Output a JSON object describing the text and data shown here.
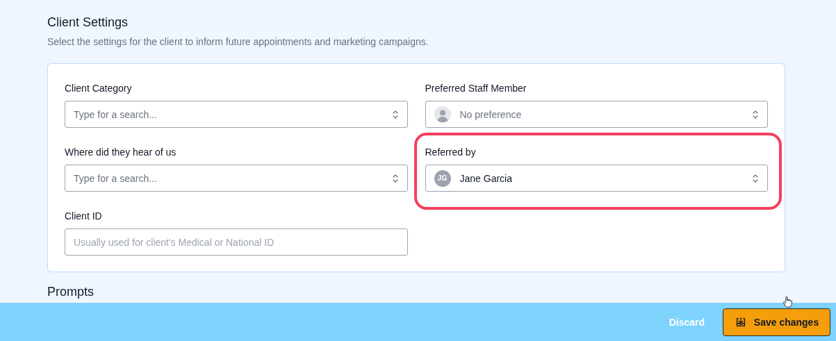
{
  "section": {
    "title": "Client Settings",
    "description": "Select the settings for the client to inform future appointments and marketing campaigns."
  },
  "fields": [
    {
      "label": "Client Category",
      "kind": "select",
      "placeholder": "Type for a search...",
      "highlighted": false
    },
    {
      "label": "Preferred Staff Member",
      "kind": "select",
      "placeholder": "No preference",
      "avatar": {
        "kind": "person"
      },
      "highlighted": false
    },
    {
      "label": "Where did they hear of us",
      "kind": "select",
      "placeholder": "Type for a search...",
      "highlighted": false
    },
    {
      "label": "Referred by",
      "kind": "select",
      "value": "Jane Garcia",
      "avatar": {
        "kind": "initials",
        "initials": "JG"
      },
      "highlighted": true
    },
    {
      "label": "Client ID",
      "kind": "text",
      "placeholder": "Usually used for client's Medical or National ID",
      "highlighted": false
    }
  ],
  "next_section": {
    "title": "Prompts"
  },
  "footer": {
    "discard": "Discard",
    "save": "Save changes"
  }
}
